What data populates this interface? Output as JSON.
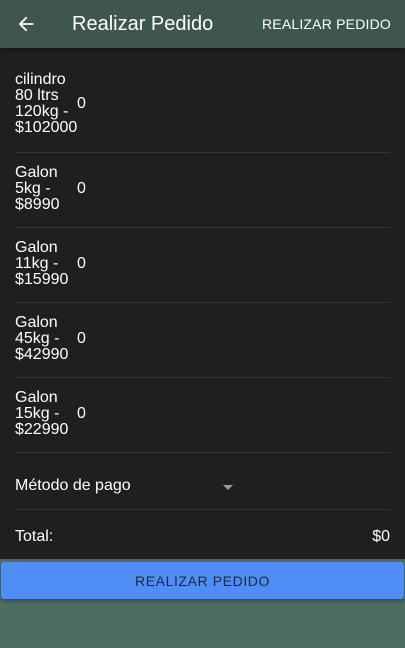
{
  "appbar": {
    "back_icon": "arrow-left-icon",
    "title": "Realizar Pedido",
    "action_label": "REALIZAR PEDIDO"
  },
  "products": [
    {
      "name": "cilindro\n80 ltrs\n120kg -\n$102000",
      "quantity": "0"
    },
    {
      "name": "Galon\n5kg -\n$8990",
      "quantity": "0"
    },
    {
      "name": "Galon\n11kg -\n$15990",
      "quantity": "0"
    },
    {
      "name": "Galon\n45kg -\n$42990",
      "quantity": "0"
    },
    {
      "name": "Galon\n15kg -\n$22990",
      "quantity": "0"
    }
  ],
  "payment": {
    "label": "Método de pago",
    "dropdown_icon": "caret-down-icon"
  },
  "total": {
    "label": "Total:",
    "value": "$0"
  },
  "submit_label": "REALIZAR PEDIDO",
  "colors": {
    "appbar": "#3f5650",
    "panel": "#1f1f1f",
    "background": "#4d6d62",
    "button": "#4f8ef7"
  }
}
